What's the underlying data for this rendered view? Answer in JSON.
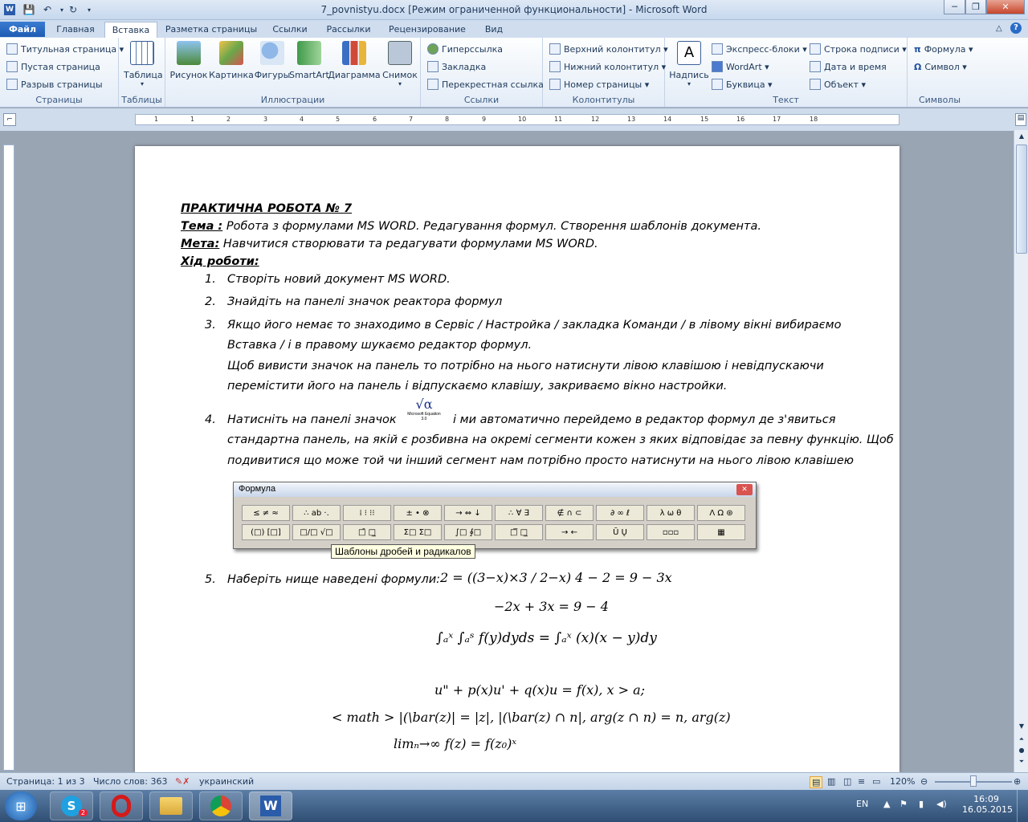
{
  "window": {
    "title": "7_povnistyu.docx [Режим ограниченной функциональности]  -  Microsoft Word"
  },
  "tabs": [
    "Файл",
    "Главная",
    "Вставка",
    "Разметка страницы",
    "Ссылки",
    "Рассылки",
    "Рецензирование",
    "Вид"
  ],
  "ribbon": {
    "pages": {
      "label": "Страницы",
      "items": [
        "Титульная страница",
        "Пустая страница",
        "Разрыв страницы"
      ]
    },
    "tables": {
      "label": "Таблицы",
      "button": "Таблица"
    },
    "illustrations": {
      "label": "Иллюстрации",
      "items": [
        "Рисунок",
        "Картинка",
        "Фигуры",
        "SmartArt",
        "Диаграмма",
        "Снимок"
      ]
    },
    "links": {
      "label": "Ссылки",
      "items": [
        "Гиперссылка",
        "Закладка",
        "Перекрестная ссылка"
      ]
    },
    "headers": {
      "label": "Колонтитулы",
      "items": [
        "Верхний колонтитул",
        "Нижний колонтитул",
        "Номер страницы"
      ]
    },
    "text": {
      "label": "Текст",
      "big": "Надпись",
      "items": [
        "Экспресс-блоки",
        "WordArt",
        "Буквица",
        "Строка подписи",
        "Дата и время",
        "Объект"
      ]
    },
    "symbols": {
      "label": "Символы",
      "items": [
        "Формула",
        "Символ"
      ]
    }
  },
  "ruler": {
    "marks": [
      "1",
      "1",
      "2",
      "3",
      "4",
      "5",
      "6",
      "7",
      "8",
      "9",
      "10",
      "11",
      "12",
      "13",
      "14",
      "15",
      "16",
      "17",
      "18"
    ]
  },
  "document": {
    "title": "ПРАКТИЧНА РОБОТА № 7",
    "theme_label": "Тема :",
    "theme_text": " Робота з формулами  MS WORD.  Редагування формул.  Створення шаблонів документа.",
    "goal_label": "Мета:",
    "goal_text": " Навчитися створювати та редагувати формулами MS WORD.",
    "progress": "Хід роботи:",
    "steps": [
      {
        "n": "1.",
        "text": "Створіть новий документ MS WORD."
      },
      {
        "n": "2.",
        "text": "Знайдіть на панелі значок реактора формул"
      },
      {
        "n": "3.",
        "text": "Якщо його немає то знаходимо в Сервіс / Настройка / закладка Команди / в лівому вікні вибираємо"
      },
      {
        "n": "",
        "text": "Вставка / і в правому шукаємо редактор формул."
      },
      {
        "n": "",
        "text": "Щоб вивисти значок на панель то потрібно на нього натиснути лівою клавішою і невідпускаючи"
      },
      {
        "n": "",
        "text": "перемістити його на панель і відпускаємо клавішу,  закриваємо вікно настройки."
      },
      {
        "n": "4.",
        "text": "Натисніть на панелі значок"
      },
      {
        "n": "",
        "text": "і ми автоматично перейдемо в редактор формул де з'явиться"
      },
      {
        "n": "",
        "text": "стандартна панель, на якій є розбивна на окремі сегменти кожен з яких відповідає за певну функцію. Щоб"
      },
      {
        "n": "",
        "text": "подивитися що може той чи інший сегмент нам потрібно просто натиснути на нього лівою клавішею"
      },
      {
        "n": "5.",
        "text": "Наберіть нище наведені формули:"
      }
    ],
    "eq_icon": {
      "line1": "Microsoft Equation",
      "line2": "3.0"
    },
    "formula_panel": {
      "title": "Формула",
      "row1": [
        "≤ ≠ ≈",
        "∴ ab ·.",
        "⁞ ⁝ ⁝⁝",
        "± • ⊗",
        "→ ⇔ ↓",
        "∴ ∀ ∃",
        "∉ ∩ ⊂",
        "∂ ∞ ℓ",
        "λ ω θ",
        "Λ Ω ⊛"
      ],
      "row2": [
        "(□) [□]",
        "□/□ √□",
        "□̄ □̲",
        "Σ□ Σ□",
        "∫□ ∮□",
        "□̅ □̲",
        "→ ←",
        "Ū Ų",
        "▫▫▫",
        "▦"
      ],
      "tooltip": "Шаблоны дробей и радикалов"
    },
    "formulas": [
      "2 = ((3−x)×3 / 2−x) 4 − 2 = 9 − 3x",
      "−2x + 3x = 9 − 4",
      "∫ₐˣ ∫ₐˢ f(y)dyds = ∫ₐˣ (x)(x − y)dy",
      "u\" + p(x)u' +  q(x)u = f(x), x > a;",
      "< math > |(\\bar(z)| = |z|, |(\\bar(z) ∩ n|, arg(z ∩ n) = n, arg(z)",
      "limₙ→∞ f(z) = f(z₀)ˣ"
    ]
  },
  "statusbar": {
    "page": "Страница: 1 из 3",
    "words": "Число слов: 363",
    "lang": "украинский",
    "zoom": "120%"
  },
  "taskbar": {
    "lang": "EN",
    "time": "16:09",
    "date": "16.05.2015",
    "skype_badge": "2"
  }
}
